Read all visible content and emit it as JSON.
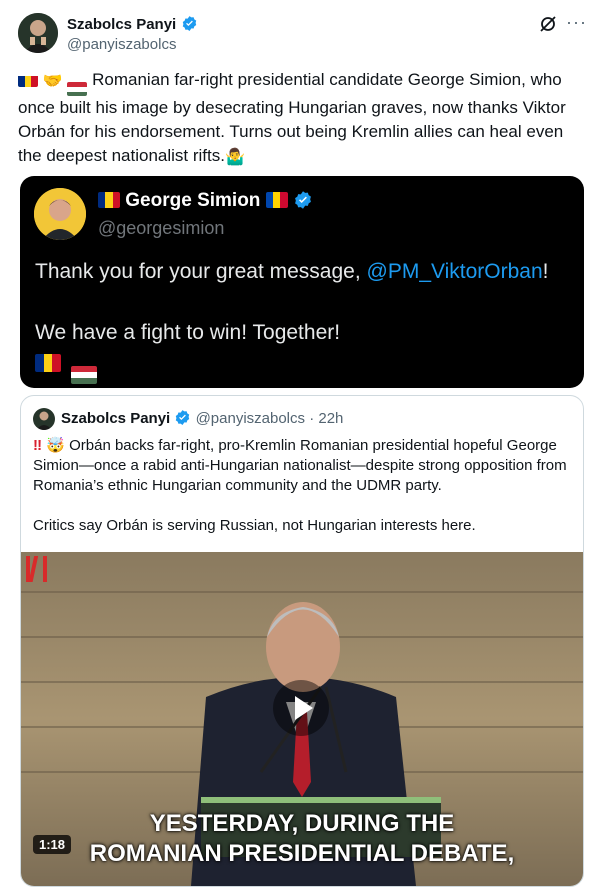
{
  "header": {
    "name": "Szabolcs Panyi",
    "handle": "@panyiszabolcs",
    "more_label": "···"
  },
  "tweet": {
    "text": "Romanian far-right presidential candidate George Simion, who once built his image by desecrating Hungarian graves, now thanks Viktor Orbán for his endorsement. Turns out being Kremlin allies can heal even the deepest nationalist rifts.",
    "leading_emojis": [
      "flag-romania",
      "handshake",
      "flag-hungary"
    ],
    "trailing_emoji": "person-shrugging"
  },
  "screenshot_card": {
    "name": "George Simion",
    "handle": "@georgesimion",
    "line1_before": "Thank you for your great message, ",
    "line1_mention": "@PM_ViktorOrban",
    "line1_after": "!",
    "line2": "We have a fight to win! Together!",
    "colors": {
      "background": "#000000",
      "mention": "#1d9bf0"
    }
  },
  "quoted_tweet": {
    "name": "Szabolcs Panyi",
    "handle": "@panyiszabolcs",
    "time": "· 22h",
    "paragraph1": "Orbán backs far-right, pro-Kremlin Romanian presidential hopeful George Simion—once a rabid anti-Hungarian nationalist—despite strong opposition from Romania’s ethnic Hungarian community and the UDMR party.",
    "paragraph2": "Critics say Orbán is serving Russian, not Hungarian interests here.",
    "emojis": [
      "double-exclamation",
      "exploding-head"
    ]
  },
  "video": {
    "caption_line1": "YESTERDAY, DURING THE",
    "caption_line2": "ROMANIAN PRESIDENTIAL DEBATE,",
    "duration": "1:18",
    "play_icon": "play-icon"
  },
  "colors": {
    "verified": "#1d9bf0",
    "text": "#0f1419",
    "secondary": "#536471"
  }
}
